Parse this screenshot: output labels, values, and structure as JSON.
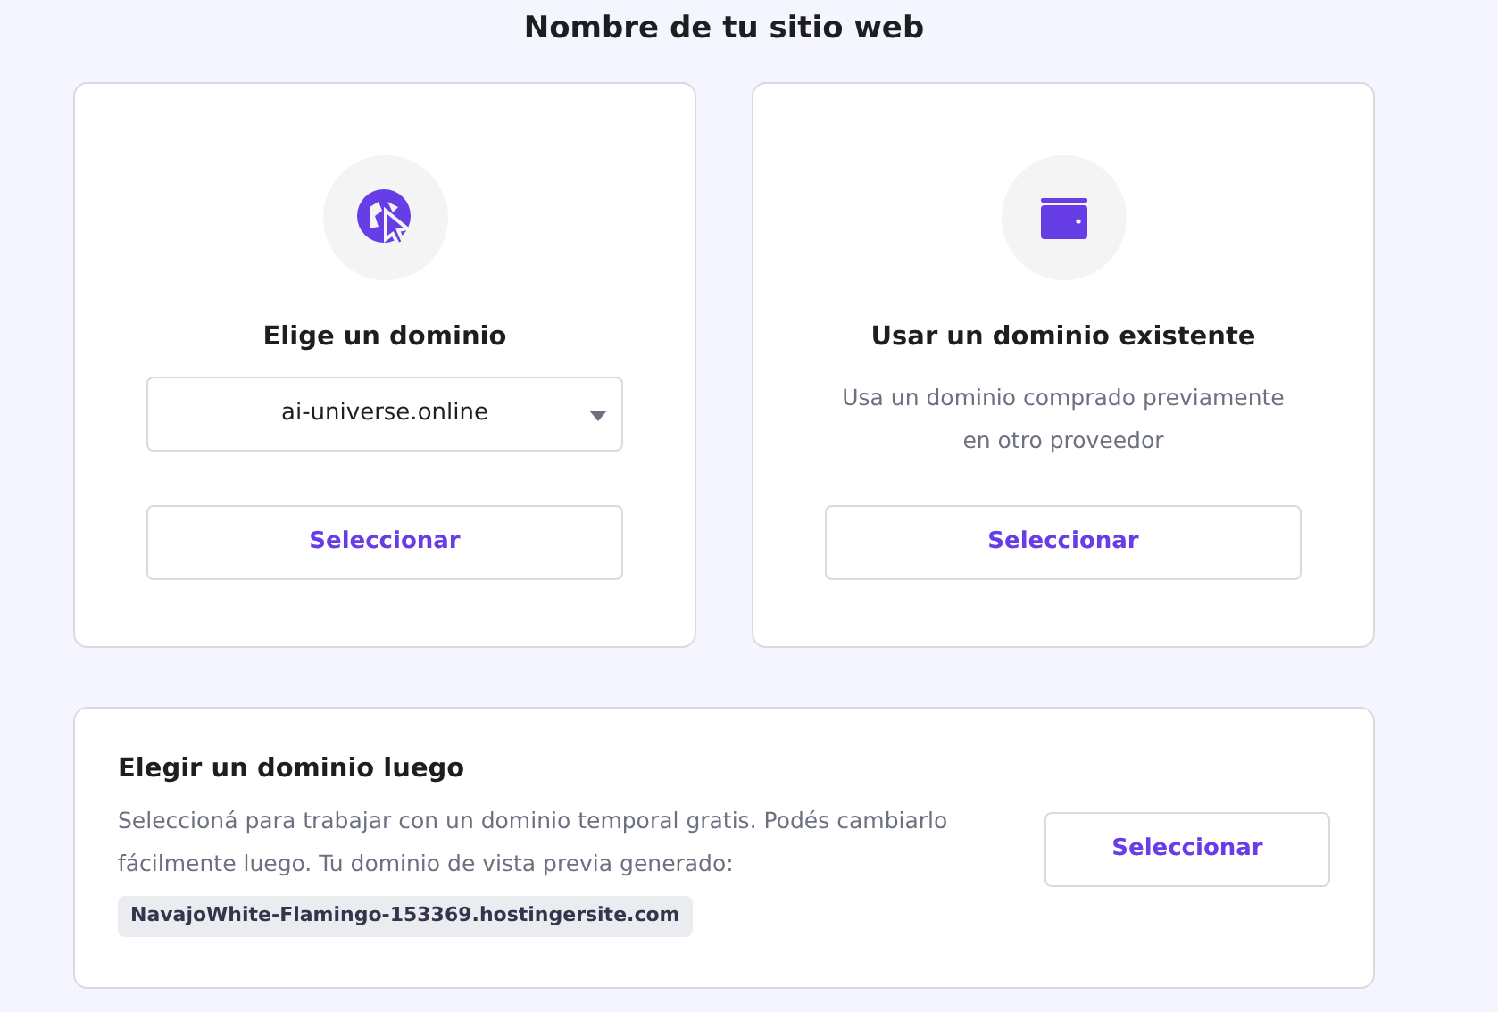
{
  "page_title": "Nombre de tu sitio web",
  "options": [
    {
      "kind": "dropdown",
      "title": "Elige un dominio",
      "select_value": "ai-universe.online",
      "button": "Seleccionar"
    },
    {
      "kind": "text",
      "title": "Usar un dominio existente",
      "description": "Usa un dominio comprado previamente en otro proveedor",
      "button": "Seleccionar"
    }
  ],
  "later": {
    "title": "Elegir un dominio luego",
    "description": "Seleccioná para trabajar con un dominio temporal gratis. Podés cambiarlo fácilmente luego. Tu dominio de vista previa generado:",
    "preview_domain": "NavajoWhite-Flamingo-153369.hostingersite.com",
    "button": "Seleccionar"
  }
}
